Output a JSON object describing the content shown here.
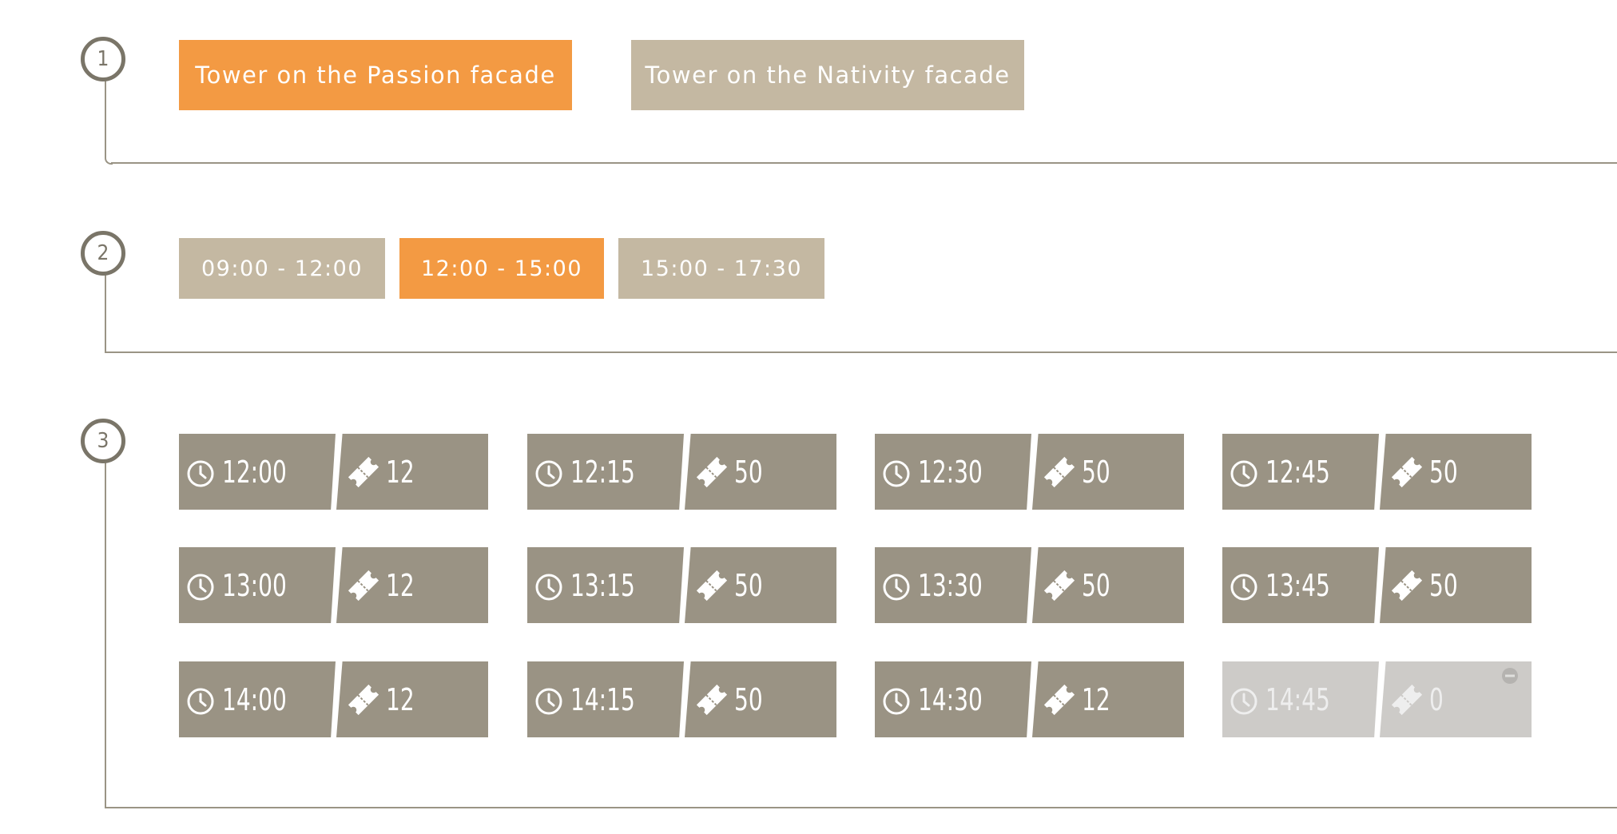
{
  "steps": [
    {
      "number": "1"
    },
    {
      "number": "2"
    },
    {
      "number": "3"
    }
  ],
  "towers": [
    {
      "label": "Tower on the Passion facade",
      "selected": true
    },
    {
      "label": "Tower on the Nativity facade",
      "selected": false
    }
  ],
  "ranges": [
    {
      "label": "09:00 - 12:00",
      "selected": false
    },
    {
      "label": "12:00 - 15:00",
      "selected": true
    },
    {
      "label": "15:00 - 17:30",
      "selected": false
    }
  ],
  "slots": [
    {
      "time": "12:00",
      "tickets": "12",
      "available": true
    },
    {
      "time": "12:15",
      "tickets": "50",
      "available": true
    },
    {
      "time": "12:30",
      "tickets": "50",
      "available": true
    },
    {
      "time": "12:45",
      "tickets": "50",
      "available": true
    },
    {
      "time": "13:00",
      "tickets": "12",
      "available": true
    },
    {
      "time": "13:15",
      "tickets": "50",
      "available": true
    },
    {
      "time": "13:30",
      "tickets": "50",
      "available": true
    },
    {
      "time": "13:45",
      "tickets": "50",
      "available": true
    },
    {
      "time": "14:00",
      "tickets": "12",
      "available": true
    },
    {
      "time": "14:15",
      "tickets": "50",
      "available": true
    },
    {
      "time": "14:30",
      "tickets": "12",
      "available": true
    },
    {
      "time": "14:45",
      "tickets": "0",
      "available": false
    }
  ],
  "icons": {
    "clock": "clock-icon",
    "ticket": "ticket-icon",
    "unavailable": "minus-circle-icon"
  },
  "colors": {
    "selected": "#f39a43",
    "unselected": "#c4b8a2",
    "slot": "#9a9384",
    "slot_disabled": "#cdcbc8",
    "line": "#9a9485"
  }
}
